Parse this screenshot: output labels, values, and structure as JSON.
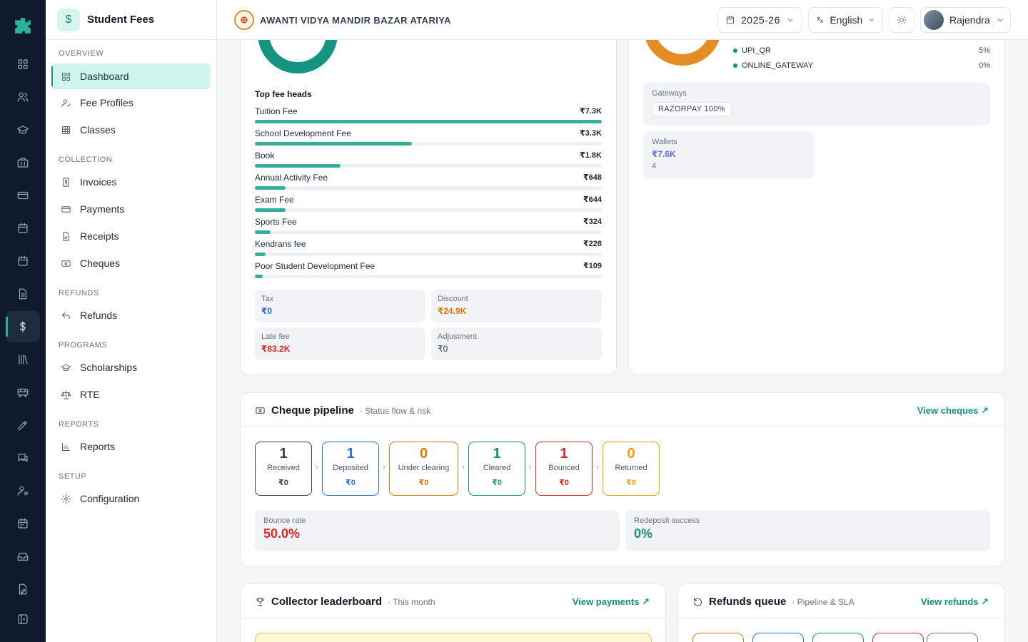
{
  "module": {
    "title": "Student Fees",
    "icon": "dollar-icon"
  },
  "rail": {
    "active_index": 9
  },
  "sidebar": {
    "sections": {
      "overview": "OVERVIEW",
      "collection": "COLLECTION",
      "refunds": "REFUNDS",
      "programs": "PROGRAMS",
      "reports": "REPORTS",
      "setup": "SETUP"
    },
    "items": {
      "dashboard": "Dashboard",
      "fee_profiles": "Fee Profiles",
      "classes": "Classes",
      "invoices": "Invoices",
      "payments": "Payments",
      "receipts": "Receipts",
      "cheques": "Cheques",
      "refunds": "Refunds",
      "scholarships": "Scholarships",
      "rte": "RTE",
      "reports": "Reports",
      "configuration": "Configuration"
    }
  },
  "topbar": {
    "school": "AWANTI VIDYA MANDIR BAZAR ATARIYA",
    "year": "2025-26",
    "language": "English",
    "user": "Rajendra"
  },
  "fee_heads": {
    "title": "Top fee heads",
    "items": [
      {
        "name": "Tuition Fee",
        "amount": "₹7.3K",
        "value": 7300
      },
      {
        "name": "School Development Fee",
        "amount": "₹3.3K",
        "value": 3300
      },
      {
        "name": "Book",
        "amount": "₹1.8K",
        "value": 1800
      },
      {
        "name": "Annual Activity Fee",
        "amount": "₹648",
        "value": 648
      },
      {
        "name": "Exam Fee",
        "amount": "₹644",
        "value": 644
      },
      {
        "name": "Sports Fee",
        "amount": "₹324",
        "value": 324
      },
      {
        "name": "Kendrans fee",
        "amount": "₹228",
        "value": 228
      },
      {
        "name": "Poor Student Development Fee",
        "amount": "₹109",
        "value": 109
      }
    ],
    "tax": {
      "label": "Tax",
      "value": "₹0",
      "color": "#2b6bd6"
    },
    "discount": {
      "label": "Discount",
      "value": "₹24.9K",
      "color": "#d97706"
    },
    "late_fee": {
      "label": "Late fee",
      "value": "₹83.2K",
      "color": "#dc2626"
    },
    "adjustment": {
      "label": "Adjustment",
      "value": "₹0",
      "color": "#374151"
    }
  },
  "modes": {
    "items": [
      {
        "name": "UPI_QR",
        "pct": "5%"
      },
      {
        "name": "ONLINE_GATEWAY",
        "pct": "0%"
      }
    ],
    "gateways_label": "Gateways",
    "gateway_chip": "RAZORPAY 100%",
    "wallets_label": "Wallets",
    "wallets_value": "₹7.6K",
    "wallets_count": "4"
  },
  "cheques": {
    "title": "Cheque pipeline",
    "subtitle": "· Status flow & risk",
    "link": "View cheques ↗",
    "stages": [
      {
        "count": "1",
        "label": "Received",
        "amount": "₹0",
        "color": "#334155"
      },
      {
        "count": "1",
        "label": "Deposited",
        "amount": "₹0",
        "color": "#2b6bd6"
      },
      {
        "count": "0",
        "label": "Under clearing",
        "amount": "₹0",
        "color": "#d97706"
      },
      {
        "count": "1",
        "label": "Cleared",
        "amount": "₹0",
        "color": "#15917b"
      },
      {
        "count": "1",
        "label": "Bounced",
        "amount": "₹0",
        "color": "#dc2626"
      },
      {
        "count": "0",
        "label": "Returned",
        "amount": "₹0",
        "color": "#f59e0b"
      }
    ],
    "bounce_rate_label": "Bounce rate",
    "bounce_rate": "50.0%",
    "redeposit_label": "Redeposit success",
    "redeposit": "0%"
  },
  "leaderboard": {
    "title": "Collector leaderboard",
    "subtitle": "· This month",
    "link": "View payments ↗"
  },
  "refunds_queue": {
    "title": "Refunds queue",
    "subtitle": "· Pipeline & SLA",
    "link": "View refunds ↗"
  }
}
